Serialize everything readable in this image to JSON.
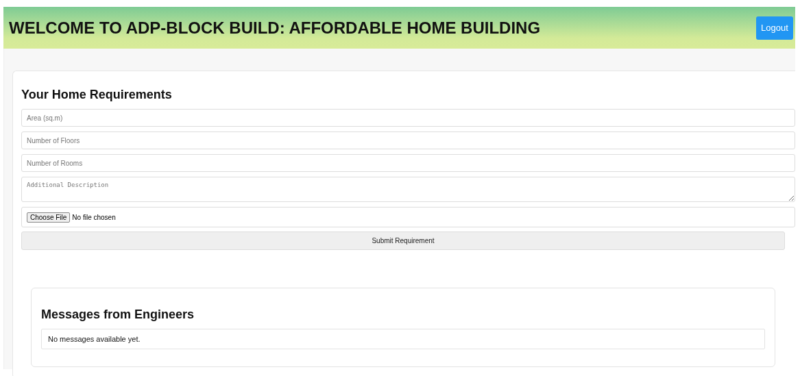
{
  "header": {
    "title": "WELCOME TO ADP-BLOCK BUILD: AFFORDABLE HOME BUILDING",
    "logout_button": "Logout"
  },
  "requirements": {
    "heading": "Your Home Requirements",
    "fields": [
      {
        "kind": "input",
        "placeholder": "Area (sq.m)"
      },
      {
        "kind": "input",
        "placeholder": "Number of Floors"
      },
      {
        "kind": "input",
        "placeholder": "Number of Rooms"
      },
      {
        "kind": "textarea",
        "placeholder": "Additional Description"
      }
    ],
    "file": {
      "button": "Choose File",
      "status": "No file chosen"
    },
    "submit_button": "Submit Requirement"
  },
  "messages": {
    "heading": "Messages from Engineers",
    "items": [
      "No messages available yet."
    ]
  }
}
